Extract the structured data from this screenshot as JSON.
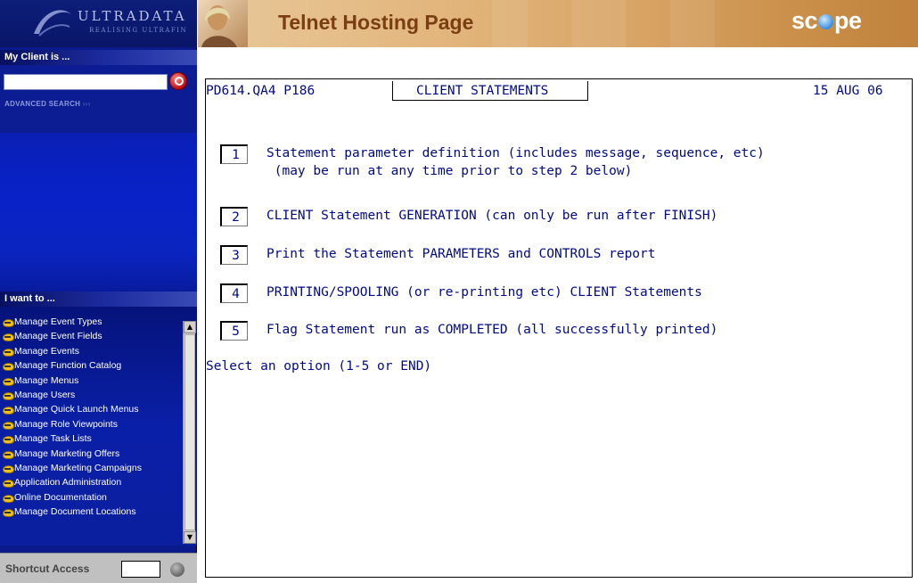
{
  "sidebar": {
    "logo": {
      "brand": "ULTRADATA",
      "tagline": "REALISING ULTRAFIN"
    },
    "client_header": "My Client is ...",
    "client_search": {
      "value": "",
      "placeholder": ""
    },
    "advanced_search": "ADVANCED SEARCH",
    "want_header": "I want to ...",
    "menu": [
      {
        "label": "Manage Event Types",
        "icon": "hardhat-icon"
      },
      {
        "label": "Manage Event Fields",
        "icon": "hardhat-icon"
      },
      {
        "label": "Manage Events",
        "icon": "hardhat-icon"
      },
      {
        "label": "Manage Function Catalog",
        "icon": "hardhat-icon"
      },
      {
        "label": "Manage Menus",
        "icon": "hardhat-icon"
      },
      {
        "label": "Manage Users",
        "icon": "hardhat-icon"
      },
      {
        "label": "Manage Quick Launch Menus",
        "icon": "hardhat-icon"
      },
      {
        "label": "Manage Role Viewpoints",
        "icon": "hardhat-icon"
      },
      {
        "label": "Manage Task Lists",
        "icon": "hardhat-icon"
      },
      {
        "label": "Manage Marketing Offers",
        "icon": "hardhat-icon"
      },
      {
        "label": "Manage Marketing Campaigns",
        "icon": "hardhat-icon"
      },
      {
        "label": "Application Administration",
        "icon": "hardhat-icon"
      },
      {
        "label": "Online Documentation",
        "icon": "hardhat-icon"
      },
      {
        "label": "Manage Document Locations",
        "icon": "hardhat-icon"
      }
    ],
    "shortcut": {
      "label": "Shortcut Access",
      "value": ""
    }
  },
  "header": {
    "title": "Telnet Hosting Page",
    "logo_pre": "sc",
    "logo_post": "pe"
  },
  "terminal": {
    "program_id": "PD614.QA4 P186",
    "screen_title": "CLIENT STATEMENTS",
    "date": "15 AUG 06",
    "options": [
      {
        "num": "1",
        "lines": [
          "Statement parameter definition (includes message, sequence, etc)",
          " (may be run at any time prior to step 2 below)"
        ]
      },
      {
        "num": "2",
        "lines": [
          "CLIENT Statement GENERATION (can only be run after FINISH)"
        ]
      },
      {
        "num": "3",
        "lines": [
          "Print the Statement PARAMETERS and CONTROLS report"
        ]
      },
      {
        "num": "4",
        "lines": [
          "PRINTING/SPOOLING (or re-printing etc) CLIENT Statements"
        ]
      },
      {
        "num": "5",
        "lines": [
          "Flag Statement run as COMPLETED (all successfully printed)"
        ]
      }
    ],
    "prompt": "Select an option (1-5 or END)"
  },
  "colors": {
    "sidebar": "#0a1a8a",
    "header_title": "#7a3e12",
    "terminal_text": "#000a86"
  }
}
